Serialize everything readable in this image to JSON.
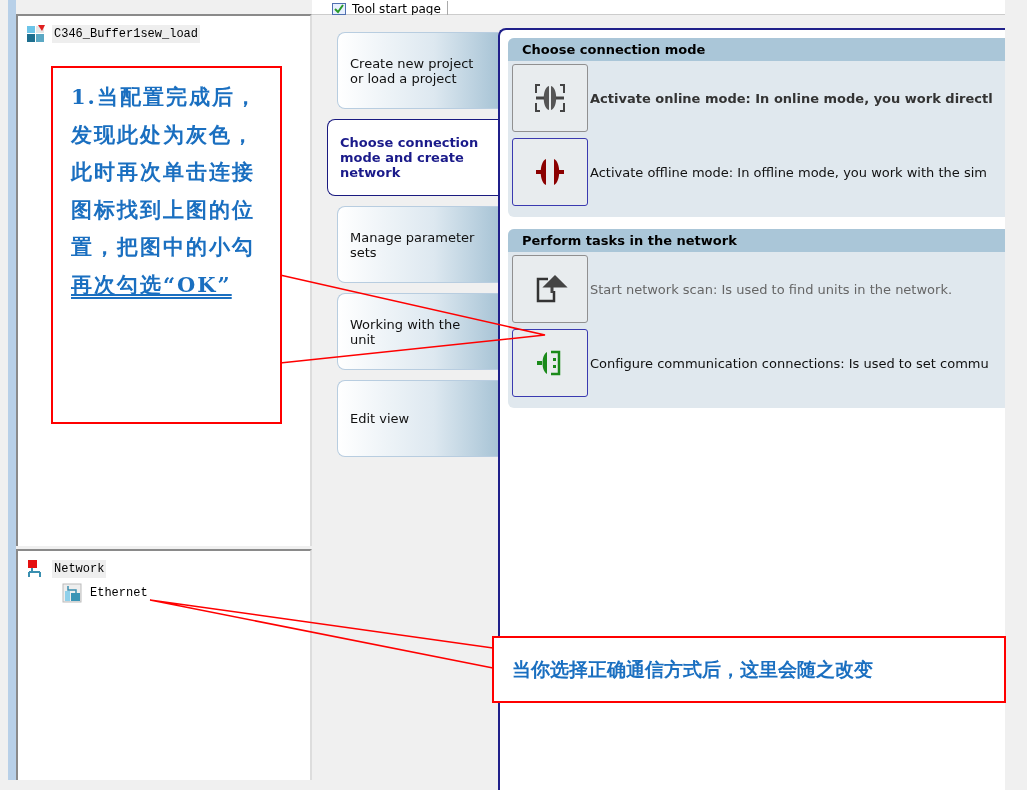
{
  "project_tree": {
    "items": [
      {
        "label": "C346_Buffer1sew_load",
        "selected": true
      }
    ]
  },
  "network_tree": {
    "items": [
      {
        "label": "Network",
        "selected": true,
        "children": [
          {
            "label": "Ethernet",
            "selected": false
          }
        ]
      }
    ]
  },
  "document_tab": {
    "label": "Tool start page"
  },
  "nav": [
    {
      "label": "Create new project or load a project",
      "selected": false
    },
    {
      "label": "Choose connection mode and create network",
      "selected": true
    },
    {
      "label": "Manage parameter sets",
      "selected": false
    },
    {
      "label": "Working with the unit",
      "selected": false
    },
    {
      "label": "Edit view",
      "selected": false
    }
  ],
  "sections": [
    {
      "title": "Choose connection mode",
      "actions": [
        {
          "kind": "online",
          "text": "Activate online mode: In online mode, you work directl",
          "selected": false,
          "bold": true,
          "disabled": false
        },
        {
          "kind": "offline",
          "text": "Activate offline mode: In offline mode, you work with the sim",
          "selected": true,
          "bold": false,
          "disabled": false
        }
      ]
    },
    {
      "title": "Perform tasks in the network",
      "actions": [
        {
          "kind": "scan",
          "text": "Start network scan: Is used to find units in the network.",
          "selected": false,
          "bold": false,
          "disabled": true
        },
        {
          "kind": "configure",
          "text": "Configure communication connections: Is used to set commu",
          "selected": true,
          "bold": false,
          "disabled": false
        }
      ]
    }
  ],
  "callouts": [
    {
      "text": "1.当配置完成后，发现此处为灰色，此时再次单击连接图标找到上图的位置，把图中的小勾",
      "underlined": "再次勾选“OK”"
    },
    {
      "text": "当你选择正确通信方式后，这里会随之改变"
    }
  ]
}
